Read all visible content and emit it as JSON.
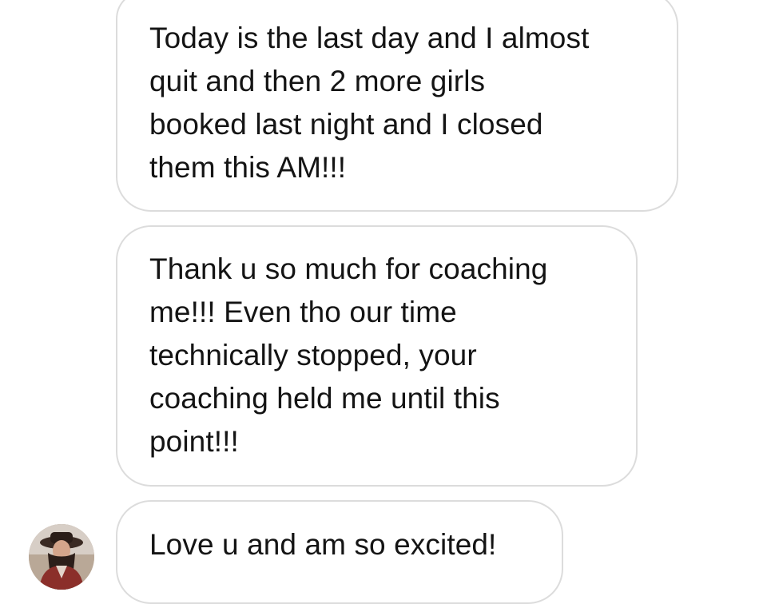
{
  "conversation": {
    "messages": [
      {
        "text": "Today is the last day and I almost\nquit and then 2 more girls\nbooked last night and I closed\nthem this AM!!!"
      },
      {
        "text": "Thank u so much for coaching\nme!!! Even tho our time\ntechnically stopped, your\ncoaching held me until this\npoint!!!"
      },
      {
        "text": "Love u and am so excited!"
      }
    ],
    "sender_avatar_icon": "avatar-photo"
  },
  "colors": {
    "bubble_border": "#dcdcdc",
    "text": "#141414",
    "background": "#ffffff"
  }
}
